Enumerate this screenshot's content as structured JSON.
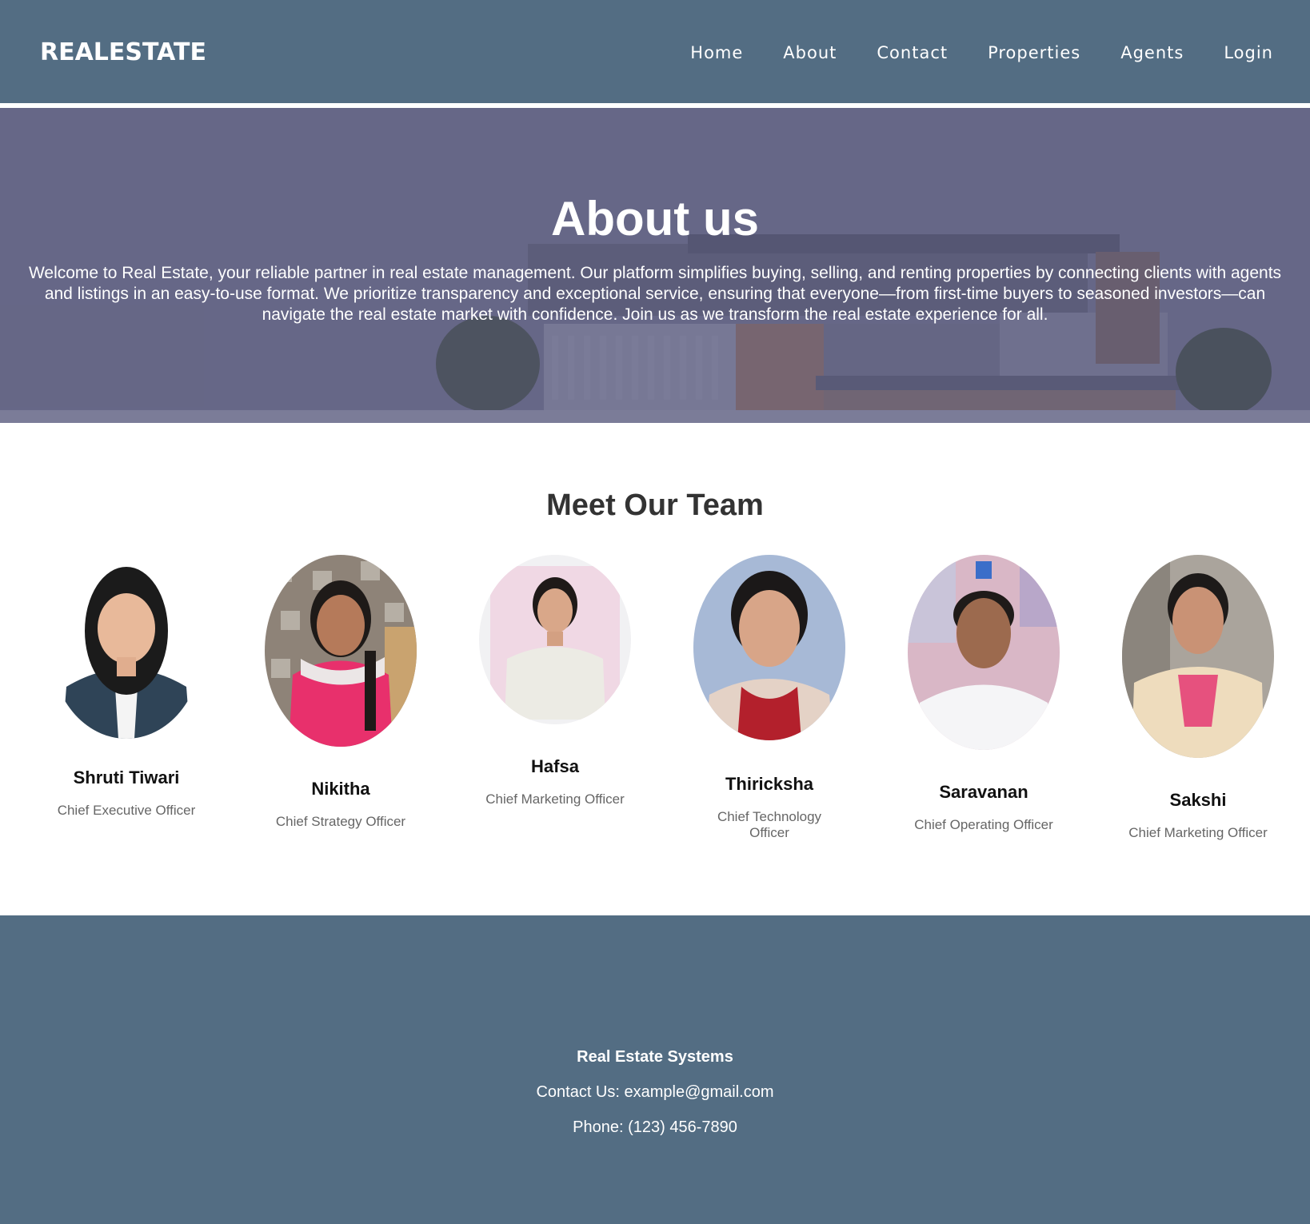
{
  "header": {
    "logo": "REALESTATE",
    "nav": [
      "Home",
      "About",
      "Contact",
      "Properties",
      "Agents",
      "Login"
    ]
  },
  "hero": {
    "title": "About us",
    "text": "Welcome to Real Estate, your reliable partner in real estate management. Our platform simplifies buying, selling, and renting properties by connecting clients with agents and listings in an easy-to-use format. We prioritize transparency and exceptional service, ensuring that everyone—from first-time buyers to seasoned investors—can navigate the real estate market with confidence. Join us as we transform the real estate experience for all."
  },
  "team": {
    "title": "Meet Our Team",
    "members": [
      {
        "name": "Shruti Tiwari",
        "role": "Chief Executive Officer"
      },
      {
        "name": "Nikitha",
        "role": "Chief Strategy Officer"
      },
      {
        "name": "Hafsa",
        "role": "Chief Marketing Officer"
      },
      {
        "name": "Thiricksha",
        "role": "Chief Technology Officer"
      },
      {
        "name": "Saravanan",
        "role": "Chief Operating Officer"
      },
      {
        "name": "Sakshi",
        "role": "Chief Marketing Officer"
      }
    ]
  },
  "footer": {
    "title": "Real Estate Systems",
    "contact": "Contact Us: example@gmail.com",
    "phone": "Phone: (123) 456-7890"
  },
  "colors": {
    "header_bg": "#536d83",
    "hero_overlay": "#6a6c88",
    "footer_bg": "#536d83",
    "text_light": "#ffffff"
  }
}
